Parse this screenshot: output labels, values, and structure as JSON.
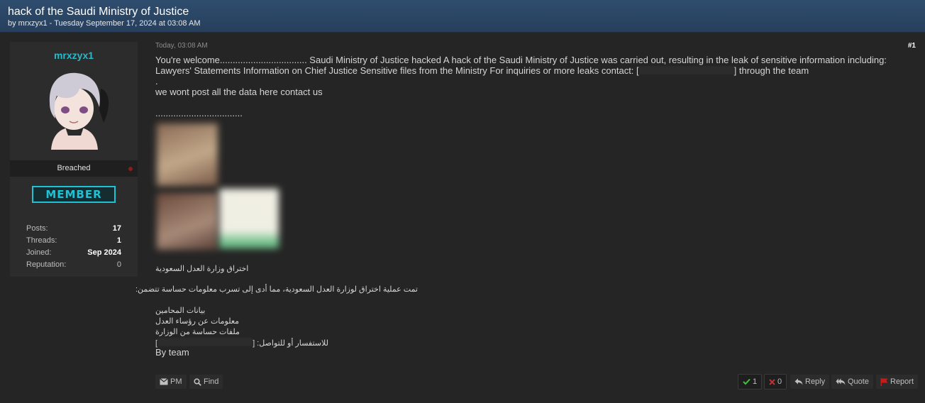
{
  "thread": {
    "title": "hack of the Saudi Ministry of Justice",
    "meta": "by mrxzyx1 - Tuesday September 17, 2024 at 03:08 AM"
  },
  "author": {
    "username": "mrxzyx1",
    "usergroup": "Breached",
    "badge": "MEMBER",
    "stats": [
      {
        "label": "Posts:",
        "value": "17"
      },
      {
        "label": "Threads:",
        "value": "1"
      },
      {
        "label": "Joined:",
        "value": "Sep 2024"
      },
      {
        "label": "Reputation:",
        "value": "0"
      }
    ]
  },
  "post": {
    "date": "Today, 03:08 AM",
    "number": "#1",
    "line1": "You're welcome.................................. Saudi Ministry of Justice hacked A hack of the Saudi Ministry of Justice was carried out, resulting in the leak of sensitive information including:",
    "line2_before": "Lawyers' Statements Information on Chief Justice Sensitive files from the Ministry For inquiries or more leaks contact: [",
    "line2_after": "] through the team",
    "line3": ".",
    "line4": "we wont post all the data here contact us",
    "line5": "..................................",
    "arabic_title": "اختراق وزارة العدل السعودية",
    "arabic_intro": "تمت عملية اختراق لوزارة العدل السعودية، مما أدى إلى تسرب معلومات حساسة تتضمن:",
    "arabic_items": [
      "بيانات المحامين",
      "معلومات عن رؤساء العدل",
      "ملفات حساسة من الوزارة"
    ],
    "arabic_contact_before": "للاستفسار أو للتواصل: [",
    "arabic_contact_after": "]",
    "by_team": "By team"
  },
  "actions": {
    "pm": "PM",
    "find": "Find",
    "upvotes": "1",
    "downvotes": "0",
    "reply": "Reply",
    "quote": "Quote",
    "report": "Report"
  },
  "colors": {
    "header_bg": "#2a4566",
    "accent": "#2bb8c9",
    "post_bg": "#252525",
    "report_red": "#c91a1a",
    "vote_green": "#3fbf3f"
  }
}
